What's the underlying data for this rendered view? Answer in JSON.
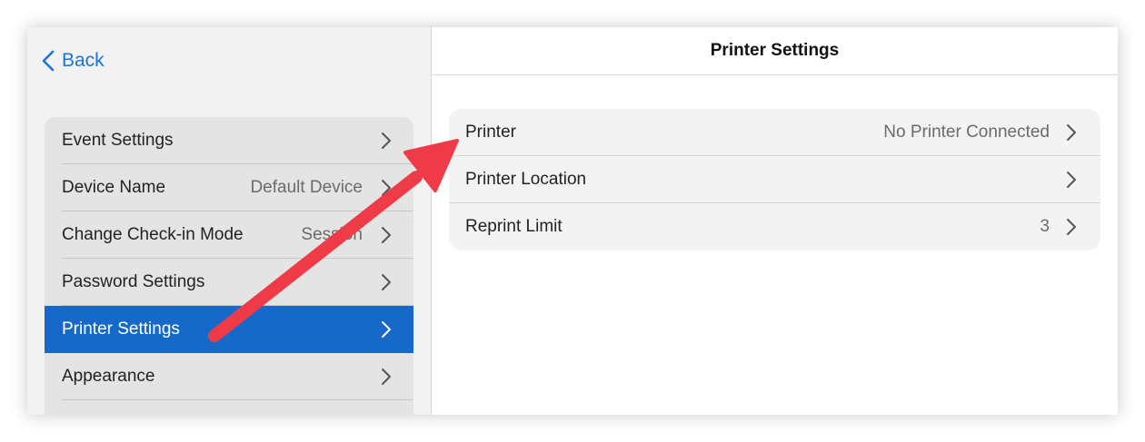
{
  "nav": {
    "back_label": "Back"
  },
  "sidebar": {
    "items": [
      {
        "label": "Event Settings",
        "value": ""
      },
      {
        "label": "Device Name",
        "value": "Default Device"
      },
      {
        "label": "Change Check-in Mode",
        "value": "Session"
      },
      {
        "label": "Password Settings",
        "value": ""
      },
      {
        "label": "Printer Settings",
        "value": "",
        "selected": true
      },
      {
        "label": "Appearance",
        "value": ""
      }
    ]
  },
  "main": {
    "title": "Printer Settings",
    "rows": [
      {
        "label": "Printer",
        "value": "No Printer Connected"
      },
      {
        "label": "Printer Location",
        "value": ""
      },
      {
        "label": "Reprint Limit",
        "value": "3"
      }
    ]
  },
  "colors": {
    "accent": "#1769c9",
    "back_link": "#1a73d9",
    "annotation_arrow": "#ee3b47"
  },
  "icons": {
    "back": "chevron-left-icon",
    "row": "chevron-right-icon",
    "annotation": "annotation-arrow"
  }
}
